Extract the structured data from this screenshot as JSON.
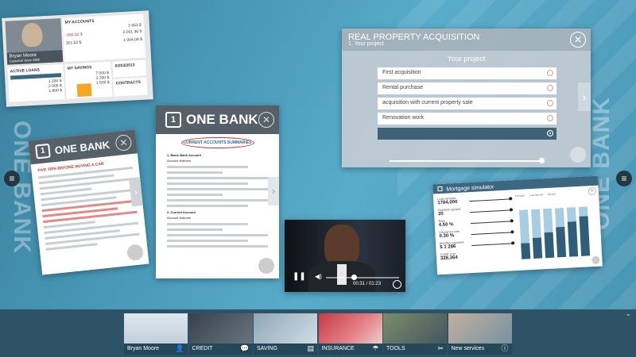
{
  "brand": {
    "name": "ONE BANK",
    "logo_char": "1"
  },
  "colors": {
    "accent": "#3d6680",
    "header_grey": "#566069",
    "bottombar": "#2f5366",
    "red_annotation": "#d42b2b"
  },
  "dashboard": {
    "profile_name": "Bryan Moore",
    "profile_sub": "Customer since 1998",
    "accounts_title": "MY ACCOUNTS",
    "accounts_values": [
      "2 653 $",
      "-300,30 $",
      "2 001 36 $",
      "301,52 $",
      "1 004,08 $"
    ],
    "active_loans": "ACTIVE LOANS",
    "loans_values": [
      "1 200 $",
      "2 005 $",
      "1 800 $"
    ],
    "savings_title": "MY SAVINGS",
    "savings_values": [
      "7 000 $",
      "3 200 $",
      "1 500 $"
    ],
    "date": "02/03/2013",
    "contracts": "CONTRACTS"
  },
  "doc_left": {
    "title": "FIVE TIPS BEFORE BUYING A CAR"
  },
  "doc_mid": {
    "title": "CURRENT ACCOUNTS SUMMARIES",
    "sections": [
      "1.  Basic Bank Account",
      "Account features",
      "2.  Current Account",
      "Account features"
    ]
  },
  "property": {
    "title": "REAL PROPERTY ACQUISITION",
    "step": "1. Your project",
    "heading": "Your project",
    "options": [
      "First acquisition",
      "Rental purchase",
      "acquisition with current property sale",
      "Renovation work",
      ""
    ]
  },
  "video": {
    "time": "00:31 / 01:23"
  },
  "mortgage": {
    "title": "Mortgage simulator",
    "fields": [
      {
        "label": "Loan amount",
        "value": "1784,000"
      },
      {
        "label": "Duration (years)",
        "value": "20"
      },
      {
        "label": "Rate",
        "value": "4.50 %"
      },
      {
        "label": "Insurance rate",
        "value": "0.30 %"
      },
      {
        "label": "Monthly payment",
        "value": "$ 1 286"
      },
      {
        "label": "Credit cost",
        "value": "328,364"
      }
    ],
    "legend": [
      "Principal",
      "Loan interest",
      "Interest"
    ]
  },
  "bottombar": {
    "tiles": [
      {
        "label": "Bryan Moore",
        "icon": "person-icon"
      },
      {
        "label": "CREDIT",
        "icon": "chat-icon"
      },
      {
        "label": "SAVING",
        "icon": "newspaper-icon"
      },
      {
        "label": "INSURANCE",
        "icon": "umbrella-icon"
      },
      {
        "label": "TOOLS",
        "icon": "tools-icon"
      },
      {
        "label": "New services",
        "icon": "info-icon"
      }
    ]
  }
}
